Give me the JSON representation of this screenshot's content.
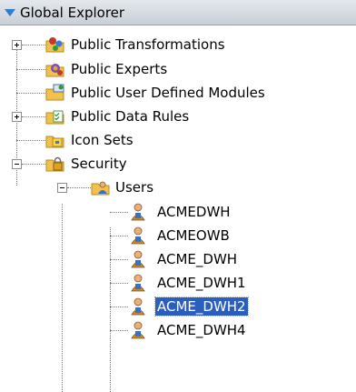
{
  "header": {
    "title": "Global Explorer",
    "caret_color": "#2b7fd3"
  },
  "tree": {
    "public_transformations": {
      "label": "Public Transformations",
      "icon": "transformation-folder-icon"
    },
    "public_experts": {
      "label": "Public Experts",
      "icon": "experts-icon"
    },
    "public_udm": {
      "label": "Public User Defined Modules",
      "icon": "user-defined-modules-icon"
    },
    "public_data_rules": {
      "label": "Public Data Rules",
      "icon": "data-rules-folder-icon"
    },
    "icon_sets": {
      "label": "Icon Sets",
      "icon": "icon-sets-folder-icon"
    },
    "security": {
      "label": "Security",
      "icon": "security-folder-icon"
    },
    "users": {
      "label": "Users",
      "icon": "users-group-icon"
    },
    "user_items": [
      {
        "label": "ACMEDWH",
        "selected": false
      },
      {
        "label": "ACMEOWB",
        "selected": false
      },
      {
        "label": "ACME_DWH",
        "selected": false
      },
      {
        "label": "ACME_DWH1",
        "selected": false
      },
      {
        "label": "ACME_DWH2",
        "selected": true
      },
      {
        "label": "ACME_DWH4",
        "selected": false
      }
    ]
  },
  "colors": {
    "selection": "#2a5fbf",
    "folder": "#f2c14a"
  }
}
